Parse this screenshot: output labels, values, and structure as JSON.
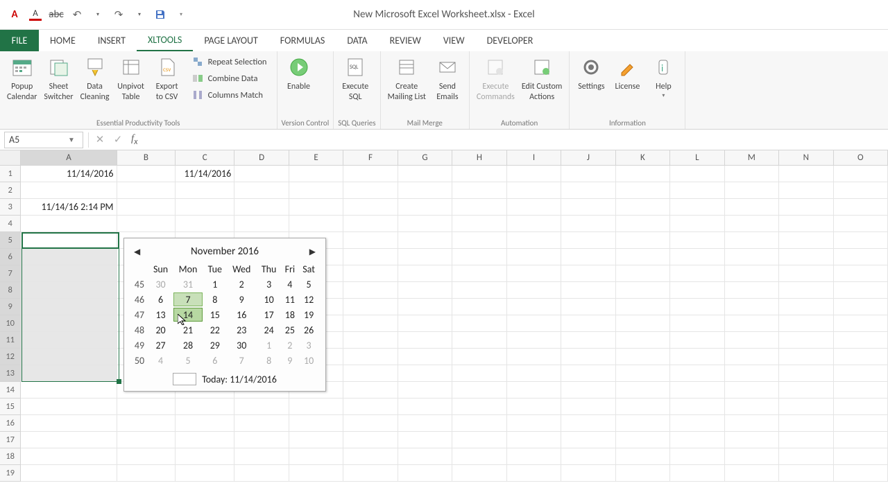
{
  "window_title": "New Microsoft Excel Worksheet.xlsx - Excel",
  "tabs": {
    "file": "FILE",
    "home": "HOME",
    "insert": "INSERT",
    "xltools": "XLTools",
    "pagelayout": "PAGE LAYOUT",
    "formulas": "FORMULAS",
    "data": "DATA",
    "review": "REVIEW",
    "view": "VIEW",
    "developer": "DEVELOPER"
  },
  "ribbon": {
    "popup": "Popup\nCalendar",
    "switcher": "Sheet\nSwitcher",
    "cleaning": "Data\nCleaning",
    "unpivot": "Unpivot\nTable",
    "export": "Export\nto CSV",
    "repeat": "Repeat Selection",
    "combine": "Combine Data",
    "columns": "Columns Match",
    "enable": "Enable",
    "execsql": "Execute\nSQL",
    "mailing": "Create\nMailing List",
    "send": "Send\nEmails",
    "execcmd": "Execute\nCommands",
    "editcustom": "Edit Custom\nActions",
    "settings": "Settings",
    "license": "License",
    "help": "Help",
    "g1": "Essential Productivity Tools",
    "g2": "Version Control",
    "g3": "SQL Queries",
    "g4": "Mail Merge",
    "g5": "Automation",
    "g6": "Information"
  },
  "namebox": "A5",
  "columns": [
    "A",
    "B",
    "C",
    "D",
    "E",
    "F",
    "G",
    "H",
    "I",
    "J",
    "K",
    "L",
    "M",
    "N",
    "O"
  ],
  "rows": [
    "1",
    "2",
    "3",
    "4",
    "5",
    "6",
    "7",
    "8",
    "9",
    "10",
    "11",
    "12",
    "13",
    "14",
    "15",
    "16",
    "17",
    "18",
    "19"
  ],
  "cells": {
    "A1": "11/14/2016",
    "C1": "11/14/2016",
    "A3": "11/14/16 2:14 PM"
  },
  "calendar": {
    "title": "November 2016",
    "dow": [
      "Sun",
      "Mon",
      "Tue",
      "Wed",
      "Thu",
      "Fri",
      "Sat"
    ],
    "weeks": [
      {
        "wk": "45",
        "d": [
          "30",
          "31",
          "1",
          "2",
          "3",
          "4",
          "5"
        ],
        "dim": [
          0,
          1
        ]
      },
      {
        "wk": "46",
        "d": [
          "6",
          "7",
          "8",
          "9",
          "10",
          "11",
          "12"
        ],
        "dim": [],
        "hov": 1
      },
      {
        "wk": "47",
        "d": [
          "13",
          "14",
          "15",
          "16",
          "17",
          "18",
          "19"
        ],
        "dim": [],
        "sel": 1
      },
      {
        "wk": "48",
        "d": [
          "20",
          "21",
          "22",
          "23",
          "24",
          "25",
          "26"
        ],
        "dim": []
      },
      {
        "wk": "49",
        "d": [
          "27",
          "28",
          "29",
          "30",
          "1",
          "2",
          "3"
        ],
        "dim": [
          4,
          5,
          6
        ]
      },
      {
        "wk": "50",
        "d": [
          "4",
          "5",
          "6",
          "7",
          "8",
          "9",
          "10"
        ],
        "dim": [
          0,
          1,
          2,
          3,
          4,
          5,
          6
        ]
      }
    ],
    "today": "Today: 11/14/2016"
  }
}
